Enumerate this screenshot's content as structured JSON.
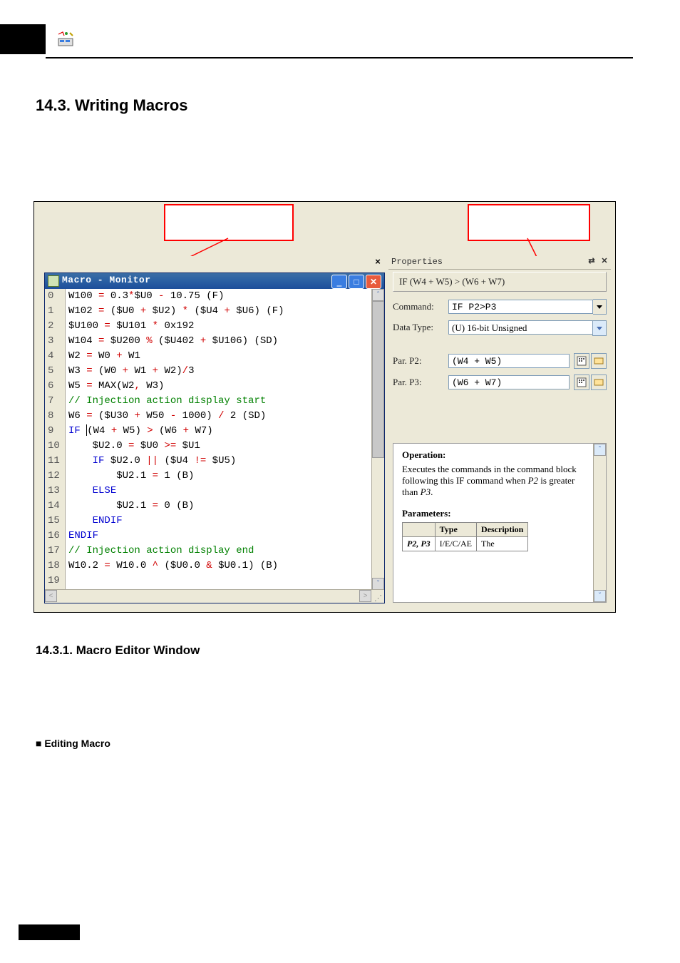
{
  "doc": {
    "heading": "14.3.  Writing Macros",
    "sub1": "14.3.1.   Macro Editor Window",
    "sub2": "■ Editing Macro"
  },
  "editor": {
    "title": "Macro - Monitor",
    "lines": [
      {
        "n": "0",
        "segs": [
          [
            "",
            "W100 "
          ],
          [
            "op",
            "="
          ],
          [
            "",
            " 0.3"
          ],
          [
            "op",
            "*"
          ],
          [
            "",
            "$U0 "
          ],
          [
            "op",
            "-"
          ],
          [
            "",
            " 10.75 (F)"
          ]
        ]
      },
      {
        "n": "1",
        "segs": [
          [
            "",
            "W102 "
          ],
          [
            "op",
            "="
          ],
          [
            "",
            " ($U0 "
          ],
          [
            "op",
            "+"
          ],
          [
            "",
            " $U2) "
          ],
          [
            "op",
            "*"
          ],
          [
            "",
            " ($U4 "
          ],
          [
            "op",
            "+"
          ],
          [
            "",
            " $U6) (F)"
          ]
        ]
      },
      {
        "n": "2",
        "segs": [
          [
            "",
            "$U100 "
          ],
          [
            "op",
            "="
          ],
          [
            "",
            " $U101 "
          ],
          [
            "op",
            "*"
          ],
          [
            "",
            " 0x192"
          ]
        ]
      },
      {
        "n": "3",
        "segs": [
          [
            "",
            "W104 "
          ],
          [
            "op",
            "="
          ],
          [
            "",
            " $U200 "
          ],
          [
            "op",
            "%"
          ],
          [
            "",
            " ($U402 "
          ],
          [
            "op",
            "+"
          ],
          [
            "",
            " $U106) (SD)"
          ]
        ]
      },
      {
        "n": "4",
        "segs": [
          [
            "",
            "W2 "
          ],
          [
            "op",
            "="
          ],
          [
            "",
            " W0 "
          ],
          [
            "op",
            "+"
          ],
          [
            "",
            " W1"
          ]
        ]
      },
      {
        "n": "5",
        "segs": [
          [
            "",
            "W3 "
          ],
          [
            "op",
            "="
          ],
          [
            "",
            " (W0 "
          ],
          [
            "op",
            "+"
          ],
          [
            "",
            " W1 "
          ],
          [
            "op",
            "+"
          ],
          [
            "",
            " W2)"
          ],
          [
            "op",
            "/"
          ],
          [
            "",
            "3"
          ]
        ]
      },
      {
        "n": "6",
        "segs": [
          [
            "",
            "W5 "
          ],
          [
            "op",
            "="
          ],
          [
            "",
            " MAX(W2"
          ],
          [
            "op",
            ","
          ],
          [
            "",
            " W3)"
          ]
        ]
      },
      {
        "n": "7",
        "segs": [
          [
            "cm",
            "// Injection action display start"
          ]
        ]
      },
      {
        "n": "8",
        "segs": [
          [
            "",
            "W6 "
          ],
          [
            "op",
            "="
          ],
          [
            "",
            " ($U30 "
          ],
          [
            "op",
            "+"
          ],
          [
            "",
            " W50 "
          ],
          [
            "op",
            "-"
          ],
          [
            "",
            " 1000) "
          ],
          [
            "op",
            "/"
          ],
          [
            "",
            " 2 (SD)"
          ]
        ]
      },
      {
        "n": "9",
        "segs": [
          [
            "kw",
            "IF "
          ],
          [
            "",
            "(W4 "
          ],
          [
            "op",
            "+"
          ],
          [
            "",
            " W5) "
          ],
          [
            "op",
            ">"
          ],
          [
            "",
            " (W6 "
          ],
          [
            "op",
            "+"
          ],
          [
            "",
            " W7)"
          ]
        ],
        "cursor": 3
      },
      {
        "n": "10",
        "segs": [
          [
            "",
            "    $U2.0 "
          ],
          [
            "op",
            "="
          ],
          [
            "",
            " $U0 "
          ],
          [
            "op",
            ">="
          ],
          [
            "",
            " $U1"
          ]
        ]
      },
      {
        "n": "11",
        "segs": [
          [
            "",
            "    "
          ],
          [
            "kw",
            "IF"
          ],
          [
            "",
            " $U2.0 "
          ],
          [
            "op",
            "||"
          ],
          [
            "",
            " ($U4 "
          ],
          [
            "op",
            "!="
          ],
          [
            "",
            " $U5)"
          ]
        ]
      },
      {
        "n": "12",
        "segs": [
          [
            "",
            "        $U2.1 "
          ],
          [
            "op",
            "="
          ],
          [
            "",
            " 1 (B)"
          ]
        ]
      },
      {
        "n": "13",
        "segs": [
          [
            "",
            "    "
          ],
          [
            "kw",
            "ELSE"
          ]
        ]
      },
      {
        "n": "14",
        "segs": [
          [
            "",
            "        $U2.1 "
          ],
          [
            "op",
            "="
          ],
          [
            "",
            " 0 (B)"
          ]
        ]
      },
      {
        "n": "15",
        "segs": [
          [
            "",
            "    "
          ],
          [
            "kw",
            "ENDIF"
          ]
        ]
      },
      {
        "n": "16",
        "segs": [
          [
            "kw",
            "ENDIF"
          ]
        ]
      },
      {
        "n": "17",
        "segs": [
          [
            "cm",
            "// Injection action display end"
          ]
        ]
      },
      {
        "n": "18",
        "segs": [
          [
            "",
            "W10.2 "
          ],
          [
            "op",
            "="
          ],
          [
            "",
            " W10.0 "
          ],
          [
            "op",
            "^"
          ],
          [
            "",
            " ($U0.0 "
          ],
          [
            "op",
            "&"
          ],
          [
            "",
            " $U0.1) (B)"
          ]
        ]
      },
      {
        "n": "19",
        "segs": []
      }
    ]
  },
  "props": {
    "title": "Properties",
    "summary": "IF (W4 + W5) > (W6 + W7)",
    "command_label": "Command:",
    "command_value": "IF P2>P3",
    "datatype_label": "Data Type:",
    "datatype_value": "(U) 16-bit Unsigned",
    "p2_label": "Par. P2:",
    "p2_value": "(W4 + W5)",
    "p3_label": "Par. P3:",
    "p3_value": "(W6 + W7)",
    "help": {
      "op_label": "Operation:",
      "op_text1": "Executes the commands in the command block following this IF command when ",
      "op_em": "P2",
      "op_text2": " is greater than ",
      "op_em2": "P3",
      "op_text3": ".",
      "params_label": "Parameters:",
      "table": {
        "h1": "",
        "h2": "Type",
        "h3": "Description",
        "r1c1": "P2, P3",
        "r1c2": "I/E/C/AE",
        "r1c3": "The"
      }
    }
  }
}
